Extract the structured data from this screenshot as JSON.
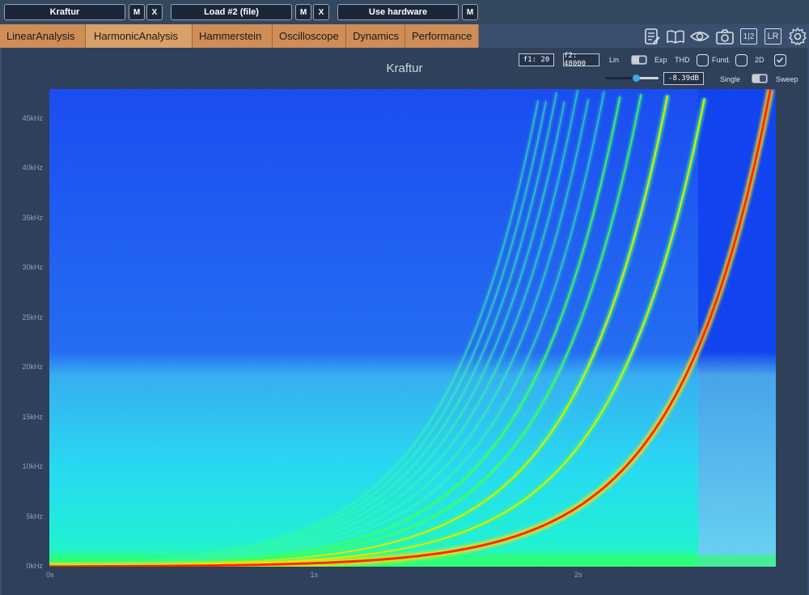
{
  "topbar": {
    "source1": {
      "label": "Kraftur",
      "m": "M",
      "x": "X"
    },
    "source2": {
      "label": "Load #2 (file)",
      "m": "M",
      "x": "X"
    },
    "source3": {
      "label": "Use hardware",
      "m": "M"
    }
  },
  "tabs": [
    "LinearAnalysis",
    "HarmonicAnalysis",
    "Hammerstein",
    "Oscilloscope",
    "Dynamics",
    "Performance"
  ],
  "toolbar_icons": [
    "notes-icon",
    "book-icon",
    "eye-icon",
    "camera-icon",
    "1-2-icon",
    "lr-icon",
    "gear-icon"
  ],
  "toolbar_text": {
    "one_two": "1|2",
    "lr": "LR"
  },
  "plot": {
    "title": "Kraftur",
    "f1": "f1: 20",
    "f2": "f2: 48000",
    "lin": "Lin",
    "exp": "Exp",
    "thd": "THD",
    "fund": "Fund.",
    "two_d": "2D",
    "db_value": "-8.39dB",
    "single": "Single",
    "sweep": "Sweep"
  },
  "colors": {
    "background": "#3a4f6e",
    "tab": "#cf8d57",
    "spectrogram_low": "#0a3df0",
    "spectrogram_mid": "#00e0ff",
    "spectrogram_high": "#ff2a00"
  },
  "chart_data": {
    "type": "heatmap",
    "title": "Kraftur",
    "x_ticks": [
      "0s",
      "1s",
      "2s"
    ],
    "y_ticks": [
      "0kHz",
      "5kHz",
      "10kHz",
      "15kHz",
      "20kHz",
      "25kHz",
      "30kHz",
      "35kHz",
      "40kHz",
      "45kHz"
    ],
    "xlim": [
      0,
      2.75
    ],
    "ylim": [
      0,
      48000
    ],
    "fundamental_sweep": {
      "f_start_hz": 20,
      "f_end_hz": 48000
    },
    "visible_harmonic_orders": [
      1,
      2,
      3,
      4,
      5,
      6,
      7,
      8,
      9,
      10,
      11,
      12
    ]
  }
}
